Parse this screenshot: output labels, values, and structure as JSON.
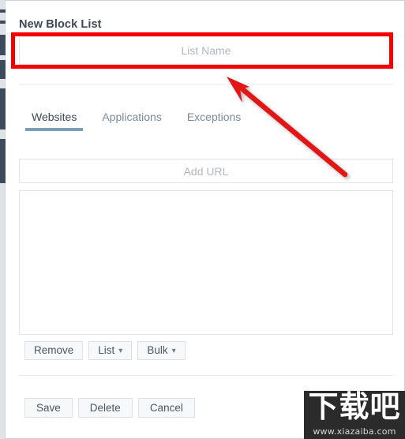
{
  "window": {
    "panel_title": "New Block List"
  },
  "form": {
    "list_name": {
      "value": "",
      "placeholder": "List Name"
    },
    "add_url": {
      "value": "",
      "placeholder": "Add URL"
    }
  },
  "tabs": [
    {
      "label": "Websites",
      "active": true
    },
    {
      "label": "Applications",
      "active": false
    },
    {
      "label": "Exceptions",
      "active": false
    }
  ],
  "list_items": [],
  "action_buttons": [
    {
      "label": "Remove",
      "caret": ""
    },
    {
      "label": "List",
      "caret": "⌄"
    },
    {
      "label": "Bulk",
      "caret": "⌄"
    }
  ],
  "footer_buttons": [
    {
      "label": "Save"
    },
    {
      "label": "Delete"
    },
    {
      "label": "Cancel"
    }
  ],
  "annotations": {
    "highlight_color": "#f40000",
    "arrow_color": "#e11717",
    "target": "list-name-input"
  },
  "watermark": {
    "logo_text": "下载吧",
    "url_text": "www.xiazaiba.com"
  },
  "theme": {
    "accent": "#7a9cb5",
    "text_dark": "#3d4852",
    "text_muted": "#7a8a99",
    "placeholder": "#b3b8bd",
    "border": "#e2e5e8",
    "button_bg": "#f7f8f9",
    "sidebar_strip": "#dfe3e8"
  }
}
